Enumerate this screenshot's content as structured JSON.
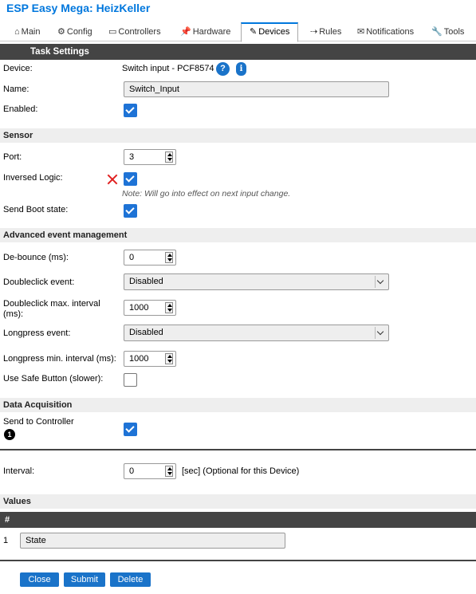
{
  "app": {
    "title": "ESP Easy Mega: HeizKeller"
  },
  "tabs": [
    {
      "icon": "⌂",
      "label": "Main"
    },
    {
      "icon": "⚙",
      "label": "Config"
    },
    {
      "icon": "▭",
      "label": "Controllers"
    },
    {
      "icon": "📌",
      "label": "Hardware"
    },
    {
      "icon": "✎",
      "label": "Devices"
    },
    {
      "icon": "⇢",
      "label": "Rules"
    },
    {
      "icon": "✉",
      "label": "Notifications"
    },
    {
      "icon": "🔧",
      "label": "Tools"
    }
  ],
  "task_settings": {
    "header": "Task Settings",
    "device_label": "Device:",
    "device_value": "Switch input - PCF8574",
    "help_icon_text": "?",
    "info_icon_text": "i",
    "name_label": "Name:",
    "name_value": "Switch_Input",
    "enabled_label": "Enabled:",
    "enabled": true
  },
  "sensor": {
    "header": "Sensor",
    "port_label": "Port:",
    "port_value": "3",
    "inversed_label": "Inversed Logic:",
    "inversed": true,
    "note": "Note: Will go into effect on next input change.",
    "bootstate_label": "Send Boot state:",
    "bootstate": true
  },
  "advanced": {
    "header": "Advanced event management",
    "debounce_label": "De-bounce (ms):",
    "debounce_value": "0",
    "dblclick_label": "Doubleclick event:",
    "dblclick_value": "Disabled",
    "dblclick_interval_label": "Doubleclick max. interval (ms):",
    "dblclick_interval_value": "1000",
    "longpress_label": "Longpress event:",
    "longpress_value": "Disabled",
    "longpress_interval_label": "Longpress min. interval (ms):",
    "longpress_interval_value": "1000",
    "safebutton_label": "Use Safe Button (slower):",
    "safebutton": false
  },
  "acquisition": {
    "header": "Data Acquisition",
    "send_label": "Send to Controller",
    "controller_badge": "1",
    "send": true,
    "interval_label": "Interval:",
    "interval_value": "0",
    "interval_suffix": "[sec] (Optional for this Device)"
  },
  "values": {
    "header": "Values",
    "col_header": "#",
    "rows": [
      {
        "index": "1",
        "name": "State"
      }
    ]
  },
  "buttons": {
    "close": "Close",
    "submit": "Submit",
    "delete": "Delete"
  },
  "colors": {
    "accent": "#1a73c9",
    "title": "#0077dd",
    "header_bg": "#444444",
    "section_bg": "#eeeeee",
    "error_x": "#e02020"
  }
}
